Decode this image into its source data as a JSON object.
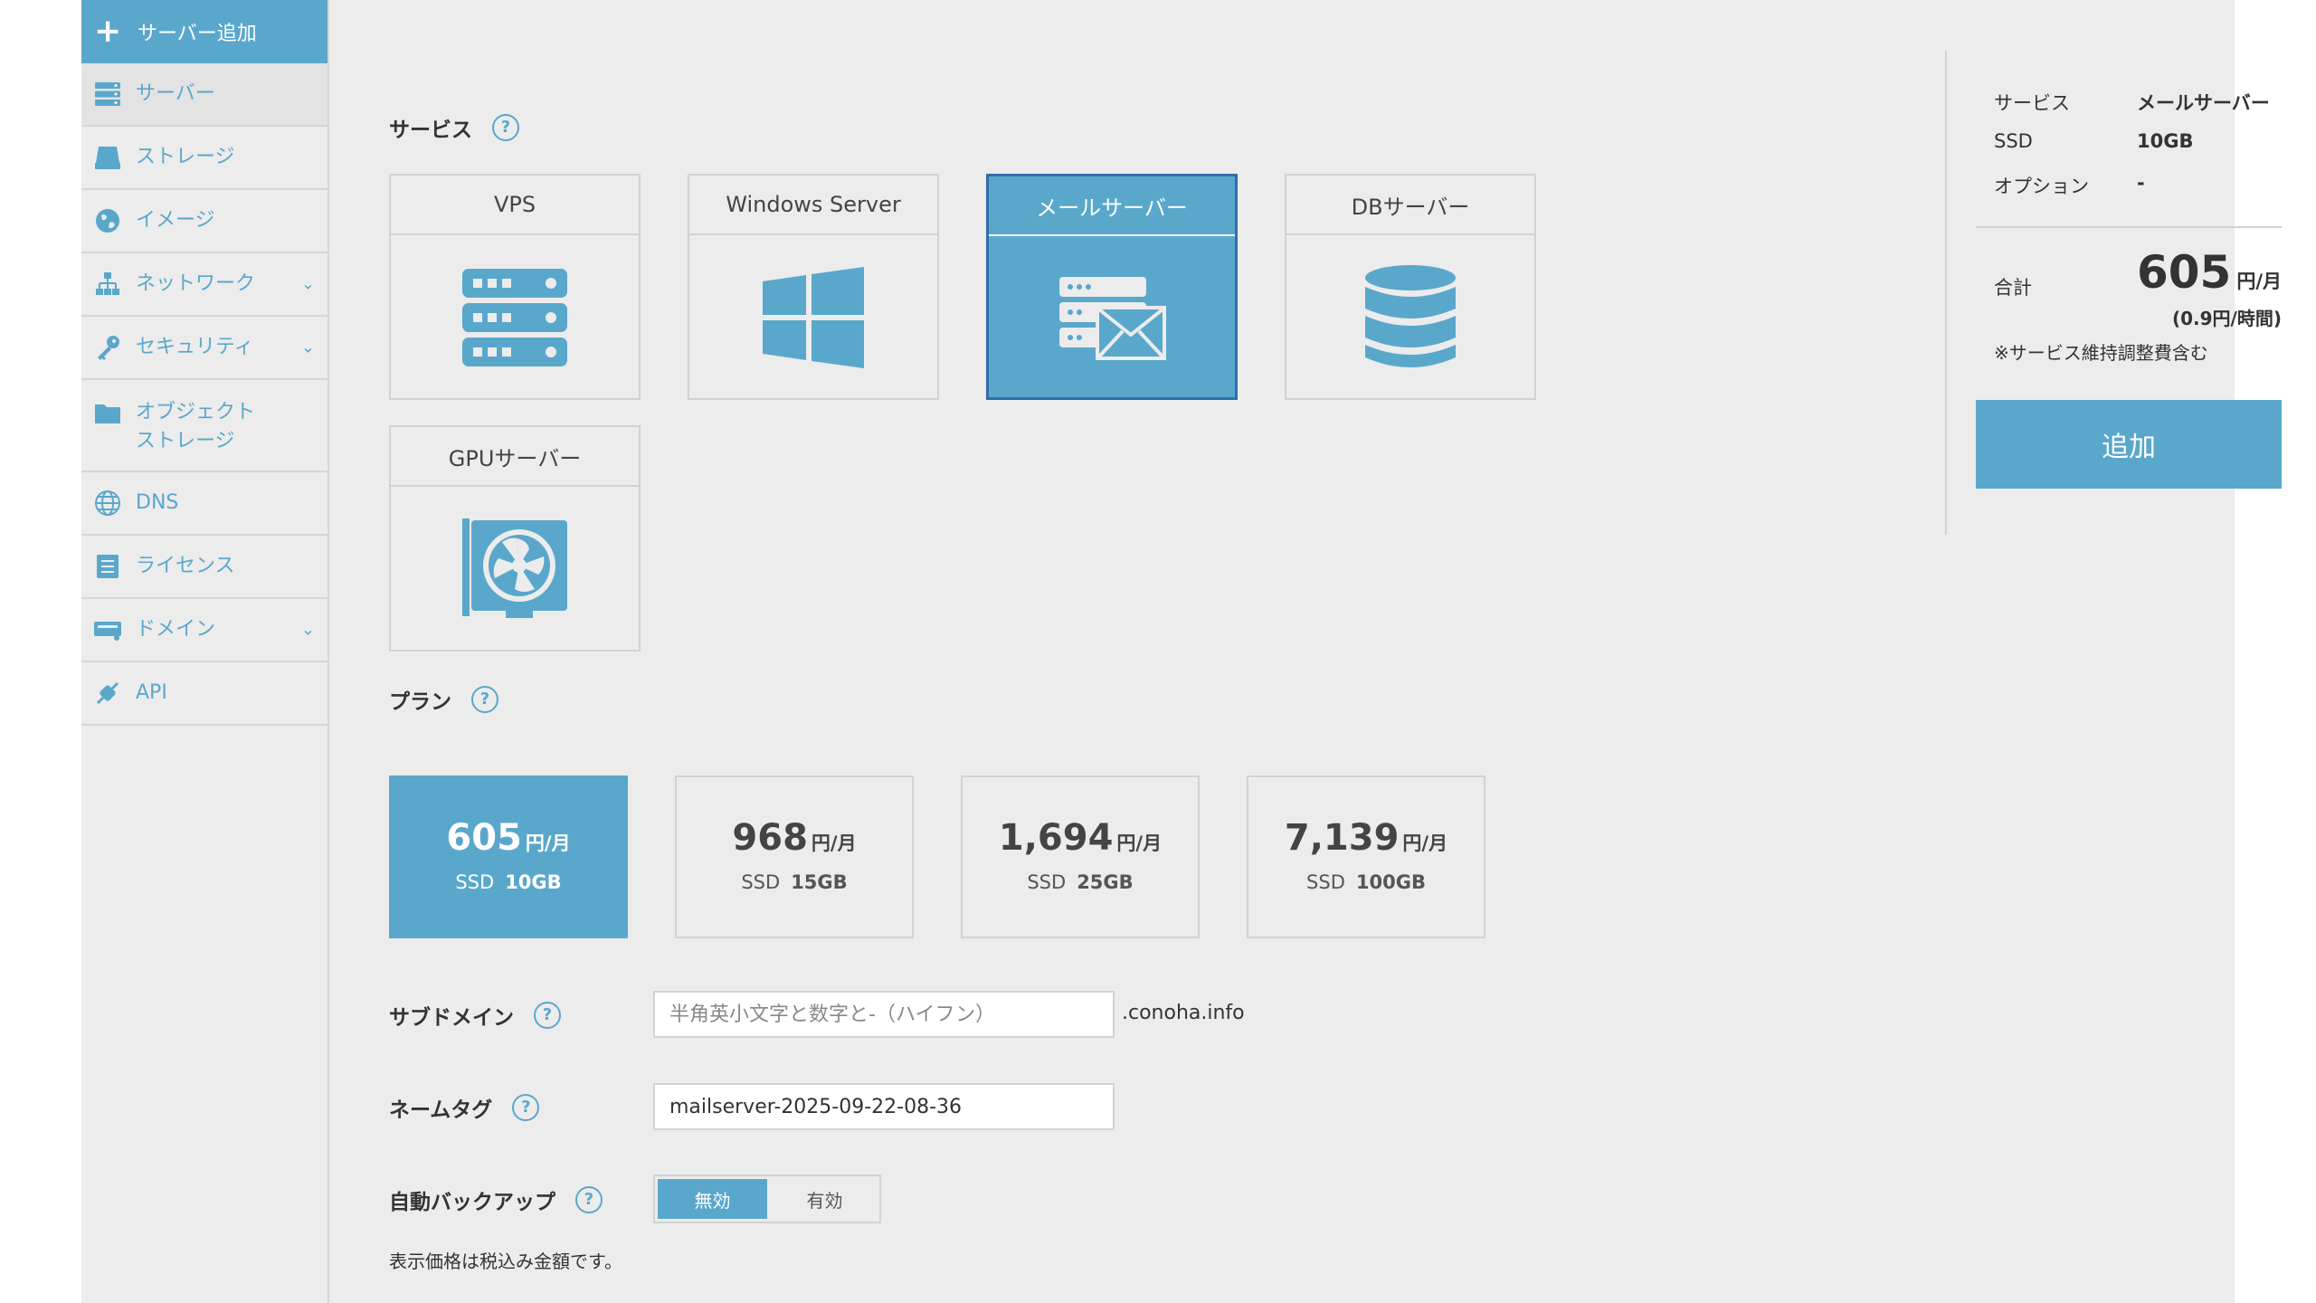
{
  "colors": {
    "accent": "#5aa7cc",
    "selected_border": "#2f6fa8",
    "background": "#ececec"
  },
  "sidebar": {
    "add_label": "サーバー追加",
    "items": [
      {
        "label": "サーバー",
        "icon": "server-icon",
        "active": true
      },
      {
        "label": "ストレージ",
        "icon": "storage-icon"
      },
      {
        "label": "イメージ",
        "icon": "image-icon"
      },
      {
        "label": "ネットワーク",
        "icon": "network-icon",
        "expandable": true
      },
      {
        "label": "セキュリティ",
        "icon": "key-icon",
        "expandable": true
      },
      {
        "label_line1": "オブジェクト",
        "label_line2": "ストレージ",
        "icon": "folder-icon"
      },
      {
        "label": "DNS",
        "icon": "globe-icon"
      },
      {
        "label": "ライセンス",
        "icon": "license-icon"
      },
      {
        "label": "ドメイン",
        "icon": "domain-icon",
        "expandable": true
      },
      {
        "label": "API",
        "icon": "api-icon"
      }
    ]
  },
  "main": {
    "service_label": "サービス",
    "help_glyph": "?",
    "services": [
      {
        "label": "VPS",
        "icon": "vps-server-icon"
      },
      {
        "label": "Windows Server",
        "icon": "windows-icon"
      },
      {
        "label": "メールサーバー",
        "icon": "mail-server-icon",
        "selected": true
      },
      {
        "label": "DBサーバー",
        "icon": "database-icon"
      },
      {
        "label": "GPUサーバー",
        "icon": "gpu-icon"
      }
    ],
    "plan_label": "プラン",
    "plans": [
      {
        "price": "605",
        "unit": "円/月",
        "ssd_label": "SSD",
        "ssd": "10GB",
        "selected": true
      },
      {
        "price": "968",
        "unit": "円/月",
        "ssd_label": "SSD",
        "ssd": "15GB"
      },
      {
        "price": "1,694",
        "unit": "円/月",
        "ssd_label": "SSD",
        "ssd": "25GB"
      },
      {
        "price": "7,139",
        "unit": "円/月",
        "ssd_label": "SSD",
        "ssd": "100GB"
      }
    ],
    "subdomain": {
      "label": "サブドメイン",
      "placeholder": "半角英小文字と数字と-（ハイフン）",
      "suffix": ".conoha.info"
    },
    "nametag": {
      "label": "ネームタグ",
      "value": "mailserver-2025-09-22-08-36"
    },
    "backup": {
      "label": "自動バックアップ",
      "off": "無効",
      "on": "有効",
      "selected": "off"
    },
    "note": "表示価格は税込み金額です。"
  },
  "summary": {
    "service_label": "サービス",
    "service_value": "メールサーバー",
    "ssd_label": "SSD",
    "ssd_value": "10GB",
    "option_label": "オプション",
    "option_value": "-",
    "total_label": "合計",
    "total_value": "605",
    "total_unit": "円/月",
    "hourly": "(0.9円/時間)",
    "note": "※サービス維持調整費含む",
    "submit_label": "追加"
  }
}
